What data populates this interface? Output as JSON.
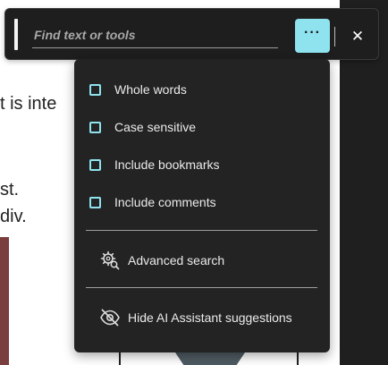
{
  "document": {
    "line_1": "t is inte",
    "line_2": "st.",
    "line_3": "div."
  },
  "search_bar": {
    "placeholder": "Find text or tools",
    "more_button_label": "···",
    "close_label": "✕"
  },
  "options_menu": {
    "checkboxes": [
      {
        "label": "Whole words",
        "checked": false
      },
      {
        "label": "Case sensitive",
        "checked": false
      },
      {
        "label": "Include bookmarks",
        "checked": false
      },
      {
        "label": "Include comments",
        "checked": false
      }
    ],
    "actions": [
      {
        "label": "Advanced search",
        "icon": "advanced-search-icon"
      },
      {
        "label": "Hide AI Assistant suggestions",
        "icon": "eye-slash-icon"
      }
    ]
  },
  "colors": {
    "accent": "#8ee3ef",
    "panel_bg": "#232323",
    "bar_bg": "#1e1e1e"
  }
}
